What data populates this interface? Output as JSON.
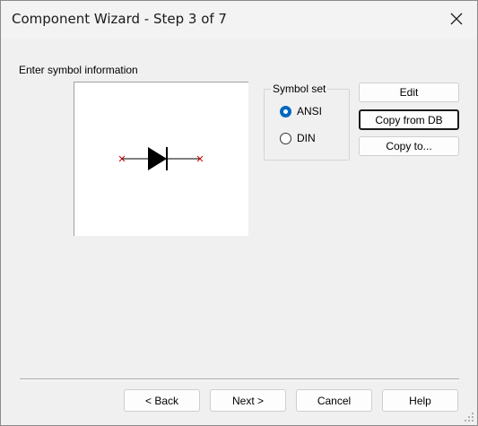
{
  "window": {
    "title": "Component Wizard - Step 3 of 7"
  },
  "main": {
    "section_label": "Enter symbol information"
  },
  "symbol_set": {
    "legend": "Symbol set",
    "options": [
      {
        "label": "ANSI",
        "checked": true
      },
      {
        "label": "DIN",
        "checked": false
      }
    ]
  },
  "side_buttons": {
    "edit": "Edit",
    "copy_from_db": "Copy from DB",
    "copy_to": "Copy to..."
  },
  "footer": {
    "back": "< Back",
    "next": "Next >",
    "cancel": "Cancel",
    "help": "Help"
  },
  "icons": {
    "close": "close-icon",
    "symbol": "diode-symbol",
    "grip": "resize-grip-icon"
  },
  "colors": {
    "accent": "#0067c0",
    "pin_marker": "#cc0000"
  }
}
